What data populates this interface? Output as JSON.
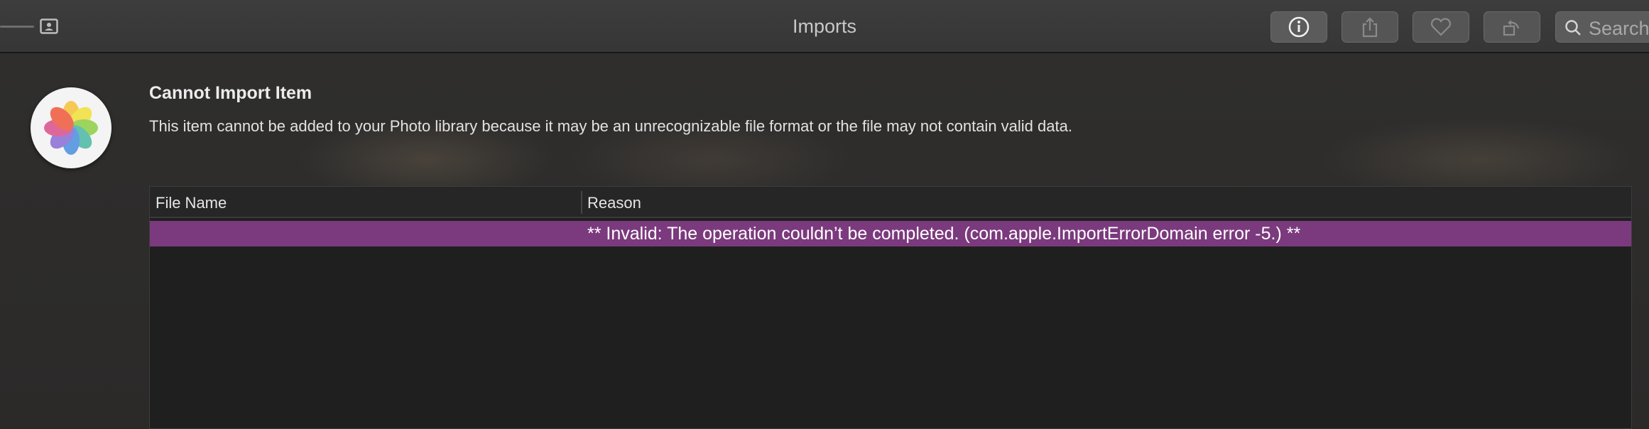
{
  "toolbar": {
    "title": "Imports",
    "search_placeholder": "Search",
    "buttons": [
      {
        "name": "info",
        "icon": "info-icon"
      },
      {
        "name": "share",
        "icon": "share-icon"
      },
      {
        "name": "favorite",
        "icon": "heart-icon"
      },
      {
        "name": "rotate",
        "icon": "rotate-icon"
      }
    ]
  },
  "dialog": {
    "heading": "Cannot Import Item",
    "message": "This item cannot be added to your Photo library because it may be an unrecognizable file format or the file may not contain valid data.",
    "app_icon": "photos-app-icon"
  },
  "table": {
    "columns": [
      "File Name",
      "Reason"
    ],
    "rows": [
      {
        "file_name": "",
        "reason": "** Invalid: The operation couldn’t be completed. (com.apple.ImportErrorDomain error -5.) **"
      }
    ],
    "selected_row_color": "#7b3a7d"
  }
}
